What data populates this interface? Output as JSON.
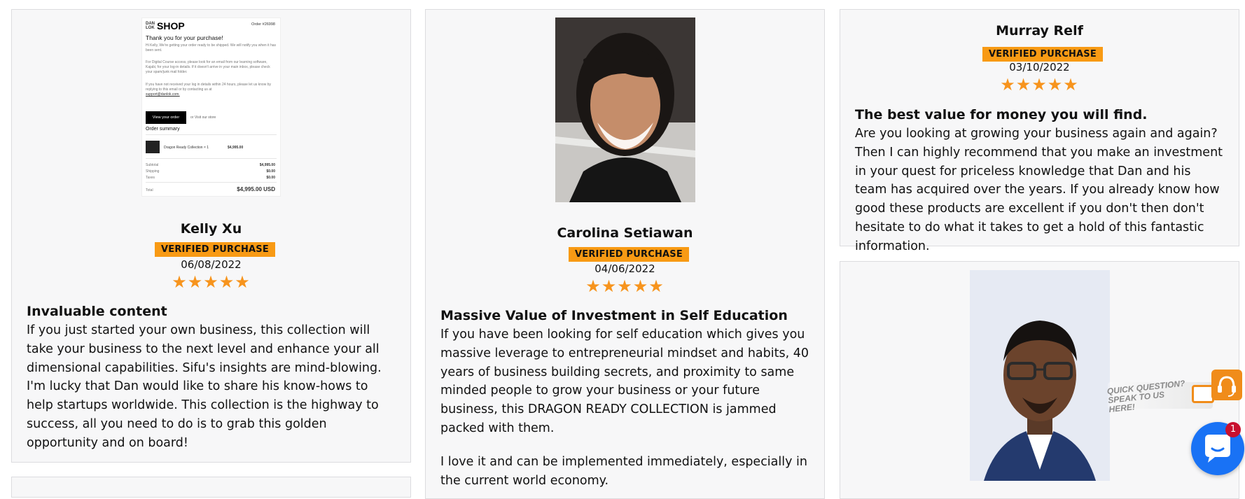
{
  "reviews": [
    {
      "name": "Kelly Xu",
      "badge": "VERIFIED PURCHASE",
      "date": "06/08/2022",
      "stars": "★★★★★",
      "title": "Invaluable content",
      "body": "If you just started your own business, this collection will take your business to the next level and enhance your all dimensional capabilities. Sifu's insights are mind-blowing. I'm lucky that Dan would like to share his know-hows to help startups worldwide. This collection is the highway to success, all you need to do is to grab this golden opportunity and on board!",
      "rating": 5
    },
    {
      "name": "Carolina Setiawan",
      "badge": "VERIFIED PURCHASE",
      "date": "04/06/2022",
      "stars": "★★★★★",
      "title": "Massive Value of Investment in Self Education",
      "body": "If you have been looking for self education which gives you massive leverage to entrepreneurial mindset and habits, 40 years of business building secrets, and proximity to same minded people to grow your business or your future business, this DRAGON READY COLLECTION is jammed packed with them.",
      "body2": "I love it and can be implemented immediately, especially in the current world economy.",
      "rating": 5
    },
    {
      "name": "Murray Relf",
      "badge": "VERIFIED PURCHASE",
      "date": "03/10/2022",
      "stars": "★★★★★",
      "title": "The best value for money you will find.",
      "body": "Are you looking at growing your business again and again? Then I can highly recommend that you make an investment in your quest for priceless knowledge that Dan and his team has acquired over the years. If you already know how good these products are excellent if you don't then don't hesitate to do what it takes to get a hold of this fantastic information.",
      "rating": 5
    }
  ],
  "receipt": {
    "logo_small": "DAN LOK",
    "logo": "SHOP",
    "order_no": "Order #26998",
    "heading": "Thank you for your purchase!",
    "p1": "Hi Kelly, We're getting your order ready to be shipped. We will notify you when it has been sent.",
    "p2": "For Digital Course access, please look for an email from our learning software, Kajabi, for your log-in details. If it doesn't arrive in your main inbox, please check your spam/junk mail folder.",
    "p3": "If you have not received your log in details within 24 hours, please let us know by replying to this email or by contacting us at",
    "email": "support@danlok.com.",
    "view_order": "View your order",
    "visit_store": "or Visit our store",
    "summary": "Order summary",
    "item": "Dragon Ready Collection × 1",
    "item_price": "$4,995.00",
    "rows": [
      {
        "label": "Subtotal",
        "value": "$4,995.00"
      },
      {
        "label": "Shipping",
        "value": "$0.00"
      },
      {
        "label": "Taxes",
        "value": "$0.00"
      }
    ],
    "total_label": "Total",
    "total_value": "$4,995.00 USD"
  },
  "widgets": {
    "quick_question": "QUICK QUESTION? SPEAK TO US HERE!",
    "chat_unread": "1"
  },
  "colors": {
    "badge": "#f89a14",
    "star": "#f7941d",
    "chat": "#1972f5",
    "headset": "#f08c1a"
  }
}
